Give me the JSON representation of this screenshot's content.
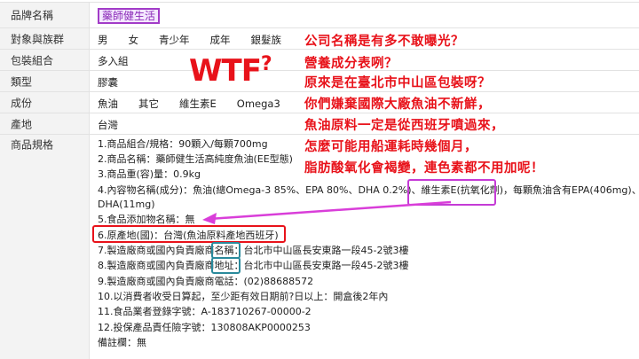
{
  "table": {
    "rows": [
      {
        "label": "品牌名稱",
        "value": "藥師健生活"
      },
      {
        "label": "對象與族群",
        "value": "男　　女　　青少年　　成年　　銀髮族"
      },
      {
        "label": "包裝組合",
        "value": "多入組"
      },
      {
        "label": "類型",
        "value": "膠囊"
      },
      {
        "label": "成份",
        "value": "魚油　　其它　　維生素E　　Omega3"
      },
      {
        "label": "產地",
        "value": "台灣"
      },
      {
        "label": "商品規格",
        "value": ""
      }
    ],
    "spec_lines": [
      "1.商品組合/規格：90顆入/每顆700mg",
      "2.商品名稱：藥師健生活高純度魚油(EE型態)",
      "3.商品重(容)量：0.9kg",
      "4.內容物名稱(成分)：魚油(總Omega-3 85%、EPA 80%、DHA 0.2%)、維生素E(抗氧化劑)，每顆魚油含有EPA(406mg)、",
      "DHA(11mg)",
      "5.食品添加物名稱：無",
      "6.原產地(國)：台灣(魚油原料產地西班牙)",
      "7.製造廠商或國內負責廠商名稱：台北市中山區長安東路一段45-2號3樓",
      "8.製造廠商或國內負責廠商地址：台北市中山區長安東路一段45-2號3樓",
      "9.製造廠商或國內負責廠商電話：(02)88688572",
      "10.以消費者收受日算起，至少距有效日期前?日以上：開盒後2年內",
      "11.食品業者登錄字號：A-183710267-00000-2",
      "12.投保產品責任險字號：130808AKP0000253",
      "備註欄：無"
    ]
  },
  "annotations": {
    "wtf": "WTF",
    "wtf_mark": "?",
    "lines": [
      "公司名稱是有多不敢曝光？",
      "營養成分表咧？",
      "原來是在臺北市中山區包裝呀？",
      "你們嫌棄國際大廠魚油不新鮮，",
      "魚油原料一定是從西班牙噴過來，",
      "怎麼可能用船運耗時幾個月，",
      "脂肪酸氧化會褐變，連色素都不用加呢！"
    ]
  },
  "colors": {
    "red": "#e8121a",
    "purple": "#c53bd6",
    "teal": "#2a8a9c",
    "label_bg": "#f3f3f3"
  }
}
